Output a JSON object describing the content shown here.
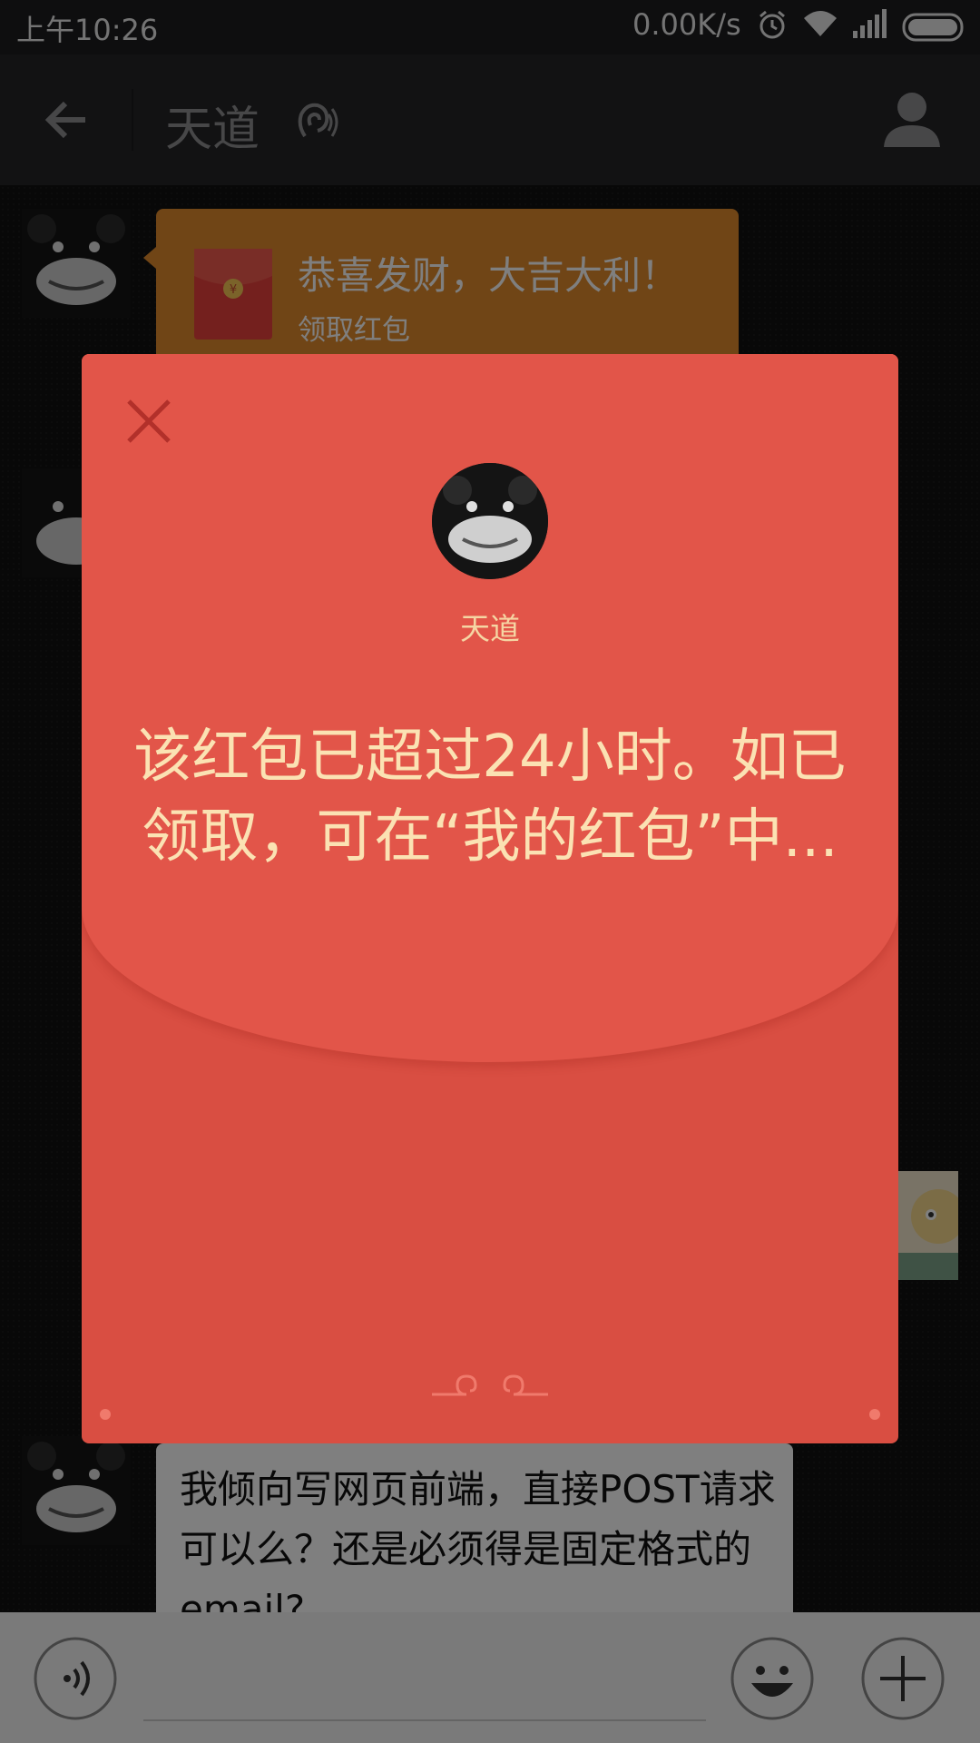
{
  "status_bar": {
    "time": "上午10:26",
    "network_speed": "0.00K/s",
    "icons": [
      "alarm-icon",
      "wifi-icon",
      "signal-icon",
      "battery-icon"
    ]
  },
  "nav": {
    "title": "天道",
    "icons": [
      "back-arrow-icon",
      "ear-icon",
      "profile-icon"
    ]
  },
  "chat": {
    "red_packet_bubble": {
      "greeting": "恭喜发财，大吉大利！",
      "action": "领取红包"
    },
    "text_message": "我倾向写网页前端，直接POST请求可以么？还是必须得是固定格式的email?"
  },
  "input_bar": {
    "icons": [
      "voice-icon",
      "emoji-icon",
      "plus-icon"
    ]
  },
  "modal": {
    "sender_name": "天道",
    "message": "该红包已超过24小时。如已领取，可在“我的红包”中...",
    "icons": [
      "close-icon",
      "cloud-ornament-icon"
    ]
  },
  "colors": {
    "modal_red": "#e25549",
    "modal_text": "#fbe2b3",
    "bubble_orange": "#e08a2c"
  }
}
